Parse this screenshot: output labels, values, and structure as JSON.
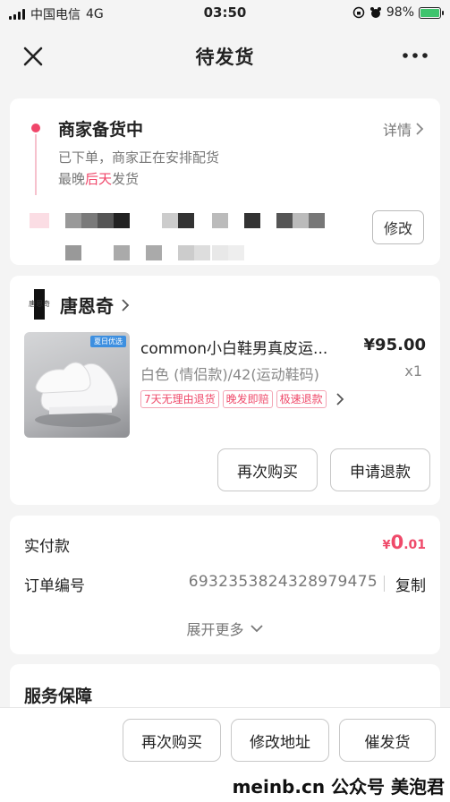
{
  "status_bar": {
    "carrier": "中国电信",
    "network": "4G",
    "time": "03:50",
    "battery": "98%",
    "battery_level": 0.98,
    "battery_color": "#3ec46d"
  },
  "nav": {
    "title": "待发货",
    "close_icon": "close-icon",
    "more_icon": "more-icon"
  },
  "order_status": {
    "title": "商家备货中",
    "detail_link": "详情",
    "line1": "已下单，商家正在安排配货",
    "line2_prefix": "最晚",
    "line2_highlight": "后天",
    "line2_suffix": "发货",
    "modify_button": "修改"
  },
  "shop": {
    "logo_text": "唐恩奇",
    "name": "唐恩奇"
  },
  "product": {
    "thumb_tag": "夏日优选",
    "name": "common小白鞋男真皮运...",
    "price": "¥95.00",
    "spec": "白色 (情侣款)/42(运动鞋码)",
    "quantity": "x1",
    "badges": [
      "7天无理由退货",
      "晚发即赔",
      "极速退款"
    ],
    "rebuy_button": "再次购买",
    "refund_button": "申请退款"
  },
  "payment": {
    "paid_label": "实付款",
    "paid_currency": "¥",
    "paid_integer": "0",
    "paid_decimal": ".01",
    "order_no_label": "订单编号",
    "order_no": "6932353824328979475",
    "copy_button": "复制",
    "expand_more": "展开更多"
  },
  "service": {
    "title": "服务保障"
  },
  "bottom_bar": {
    "rebuy": "再次购买",
    "modify_address": "修改地址",
    "urge_ship": "催发货"
  },
  "watermark": "meinb.cn  公众号 美泡君",
  "colors": {
    "accent": "#ef4a6a",
    "background": "#f4f4f4"
  }
}
